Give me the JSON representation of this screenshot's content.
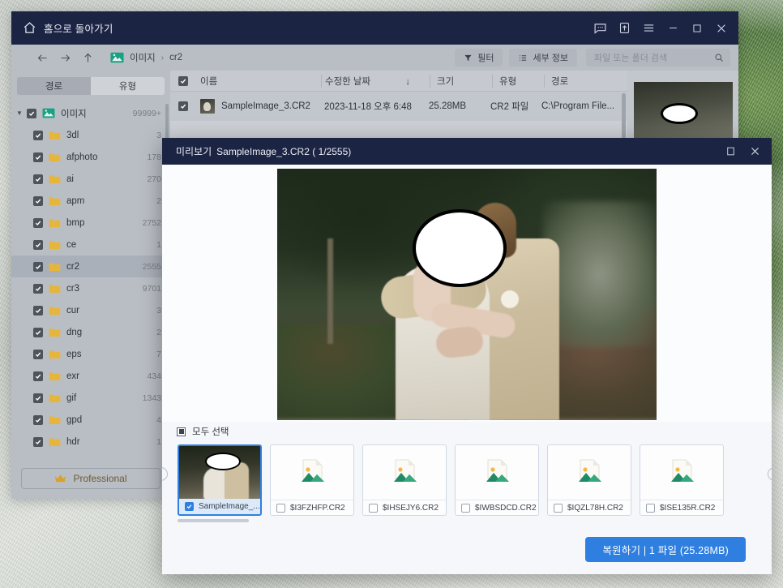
{
  "window": {
    "title": "홈으로 돌아가기",
    "home_icon": "home-icon",
    "controls": {
      "feedback": "feedback-icon",
      "upgrade": "upgrade-icon",
      "menu": "hamburger-menu-icon",
      "minimize": "minimize-icon",
      "maximize": "maximize-icon",
      "close": "close-icon"
    }
  },
  "navbar": {
    "back": "back-arrow-icon",
    "forward": "forward-arrow-icon",
    "up": "up-arrow-icon",
    "breadcrumb": [
      "이미지",
      "cr2"
    ],
    "separator": "›",
    "filter_label": "필터",
    "details_label": "세부 정보",
    "search_placeholder": "파일 또는 폴더 검색"
  },
  "sidebar": {
    "tabs": [
      {
        "label": "경로",
        "active": true
      },
      {
        "label": "유형",
        "active": false
      }
    ],
    "root": {
      "label": "이미지",
      "count": "99999+"
    },
    "items": [
      {
        "label": "3dl",
        "count": "3"
      },
      {
        "label": "afphoto",
        "count": "178"
      },
      {
        "label": "ai",
        "count": "270"
      },
      {
        "label": "apm",
        "count": "2"
      },
      {
        "label": "bmp",
        "count": "2752"
      },
      {
        "label": "ce",
        "count": "1"
      },
      {
        "label": "cr2",
        "count": "2555",
        "selected": true
      },
      {
        "label": "cr3",
        "count": "9701"
      },
      {
        "label": "cur",
        "count": "3"
      },
      {
        "label": "dng",
        "count": "2"
      },
      {
        "label": "eps",
        "count": "7"
      },
      {
        "label": "exr",
        "count": "434"
      },
      {
        "label": "gif",
        "count": "1343"
      },
      {
        "label": "gpd",
        "count": "4"
      },
      {
        "label": "hdr",
        "count": "1"
      }
    ],
    "professional_label": "Professional",
    "crown_icon": "crown-icon"
  },
  "filelist": {
    "columns": [
      "이름",
      "수정한 날짜",
      "크기",
      "유형",
      "경로"
    ],
    "sort_indicator": "↓",
    "rows": [
      {
        "name": "SampleImage_3.CR2",
        "date": "2023-11-18 오후 6:48",
        "size": "25.28MB",
        "type": "CR2 파일",
        "path": "C:\\Program File..."
      }
    ]
  },
  "dialog": {
    "title_prefix": "미리보기",
    "title_file": "SampleImage_3.CR2 ( 1/2555)",
    "maximize": "maximize-icon",
    "close": "close-icon",
    "select_all_label": "모두 선택",
    "prev_label": "‹",
    "next_label": "›",
    "thumbnails": [
      {
        "name": "SampleImage_...",
        "checked": true,
        "selected": true,
        "has_preview": true
      },
      {
        "name": "$I3FZHFP.CR2",
        "checked": false,
        "selected": false,
        "has_preview": false
      },
      {
        "name": "$IHSEJY6.CR2",
        "checked": false,
        "selected": false,
        "has_preview": false
      },
      {
        "name": "$IWBSDCD.CR2",
        "checked": false,
        "selected": false,
        "has_preview": false
      },
      {
        "name": "$IQZL78H.CR2",
        "checked": false,
        "selected": false,
        "has_preview": false
      },
      {
        "name": "$ISE135R.CR2",
        "checked": false,
        "selected": false,
        "has_preview": false
      }
    ],
    "recover_button": "복원하기 | 1 파일 (25.28MB)"
  },
  "colors": {
    "titlebar": "#1c2444",
    "accent": "#2f7fe0",
    "window_bg": "#c9cdd2",
    "dialog_bg": "#f5f7fa",
    "pro_gold": "#d9a22e"
  }
}
